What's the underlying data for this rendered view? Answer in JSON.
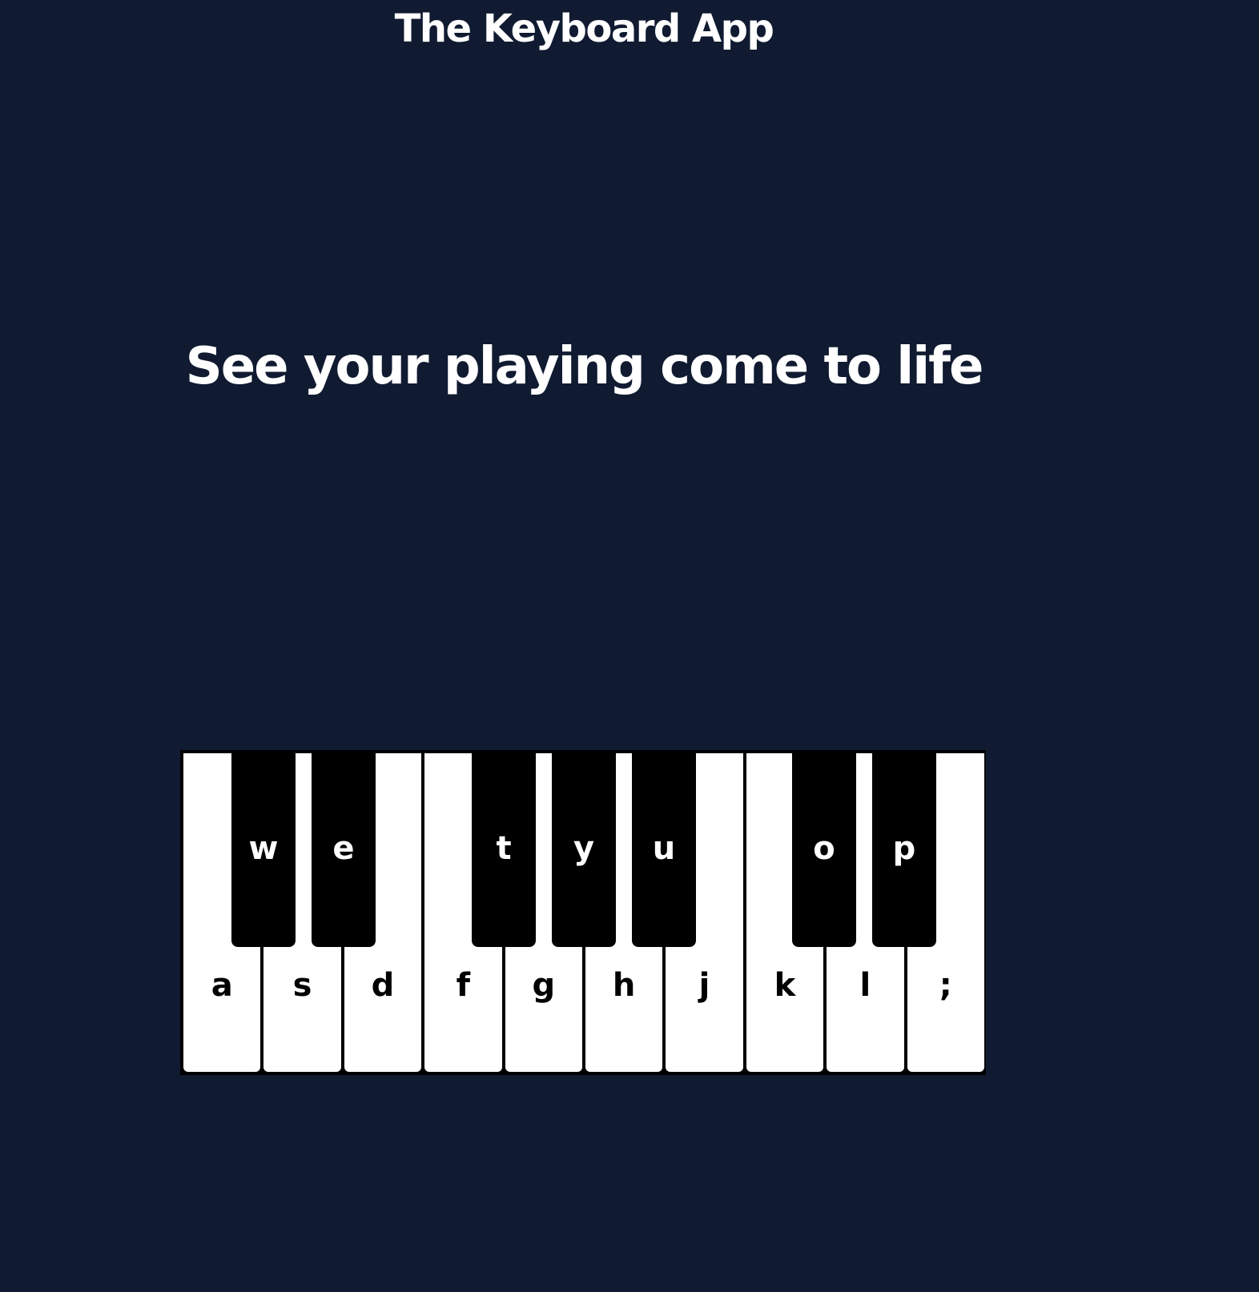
{
  "header": {
    "title": "The Keyboard App"
  },
  "hero": {
    "text": "See your playing come to life"
  },
  "keyboard": {
    "white_keys": [
      "a",
      "s",
      "d",
      "f",
      "g",
      "h",
      "j",
      "k",
      "l",
      ";"
    ],
    "black_keys": [
      "w",
      "e",
      "t",
      "y",
      "u",
      "o",
      "p"
    ]
  },
  "colors": {
    "background": "#101a31",
    "white_key": "#ffffff",
    "black_key": "#000000"
  }
}
